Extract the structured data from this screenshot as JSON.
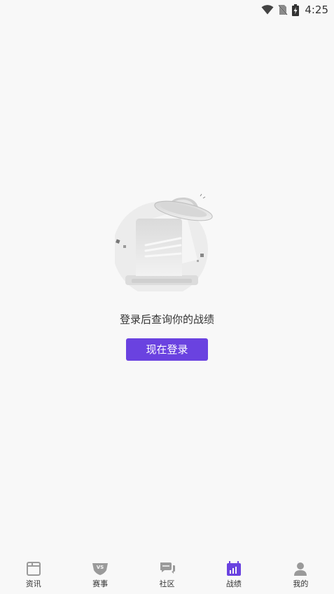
{
  "status_bar": {
    "time": "4:25",
    "icons": [
      "wifi-icon",
      "no-sim-icon",
      "battery-charging-icon"
    ]
  },
  "empty_state": {
    "illustration": "ufo-document-illustration",
    "message": "登录后查询你的战绩",
    "login_button_label": "现在登录"
  },
  "bottom_nav": {
    "items": [
      {
        "label": "资讯",
        "icon": "news-icon",
        "active": false
      },
      {
        "label": "赛事",
        "icon": "vs-match-icon",
        "active": false
      },
      {
        "label": "社区",
        "icon": "chat-bubbles-icon",
        "active": false
      },
      {
        "label": "战绩",
        "icon": "stats-chart-icon",
        "active": true
      },
      {
        "label": "我的",
        "icon": "user-icon",
        "active": false
      }
    ]
  },
  "colors": {
    "accent": "#6a42e0",
    "background": "#f8f8f8",
    "inactive_icon": "#9a9a9a",
    "text": "#333333"
  }
}
